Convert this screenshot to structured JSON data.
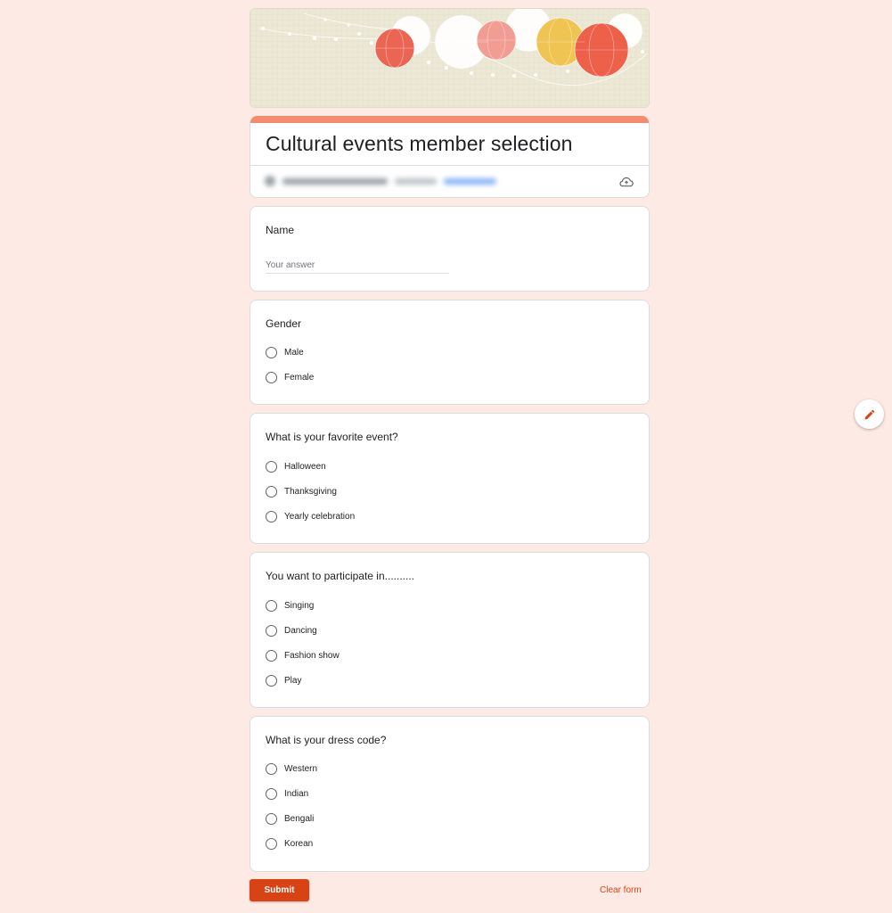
{
  "form": {
    "title": "Cultural events member selection",
    "account_hint": "",
    "accent_color": "#f28b6f"
  },
  "questions": [
    {
      "title": "Name",
      "type": "text",
      "placeholder": "Your answer"
    },
    {
      "title": "Gender",
      "type": "radio",
      "options": [
        "Male",
        "Female"
      ]
    },
    {
      "title": "What is your favorite event?",
      "type": "radio",
      "options": [
        "Halloween",
        "Thanksgiving",
        "Yearly celebration"
      ]
    },
    {
      "title": "You want to participate in..........",
      "type": "radio",
      "options": [
        "Singing",
        "Dancing",
        "Fashion show",
        "Play"
      ]
    },
    {
      "title": "What is your dress code?",
      "type": "radio",
      "options": [
        "Western",
        "Indian",
        "Bengali",
        "Korean"
      ]
    }
  ],
  "actions": {
    "submit_label": "Submit",
    "clear_label": "Clear form"
  },
  "icons": {
    "cloud": "cloud-sync-icon",
    "edit": "pencil-icon"
  },
  "colors": {
    "background": "#fdeae5",
    "button": "#d84315",
    "link": "#d84315"
  }
}
